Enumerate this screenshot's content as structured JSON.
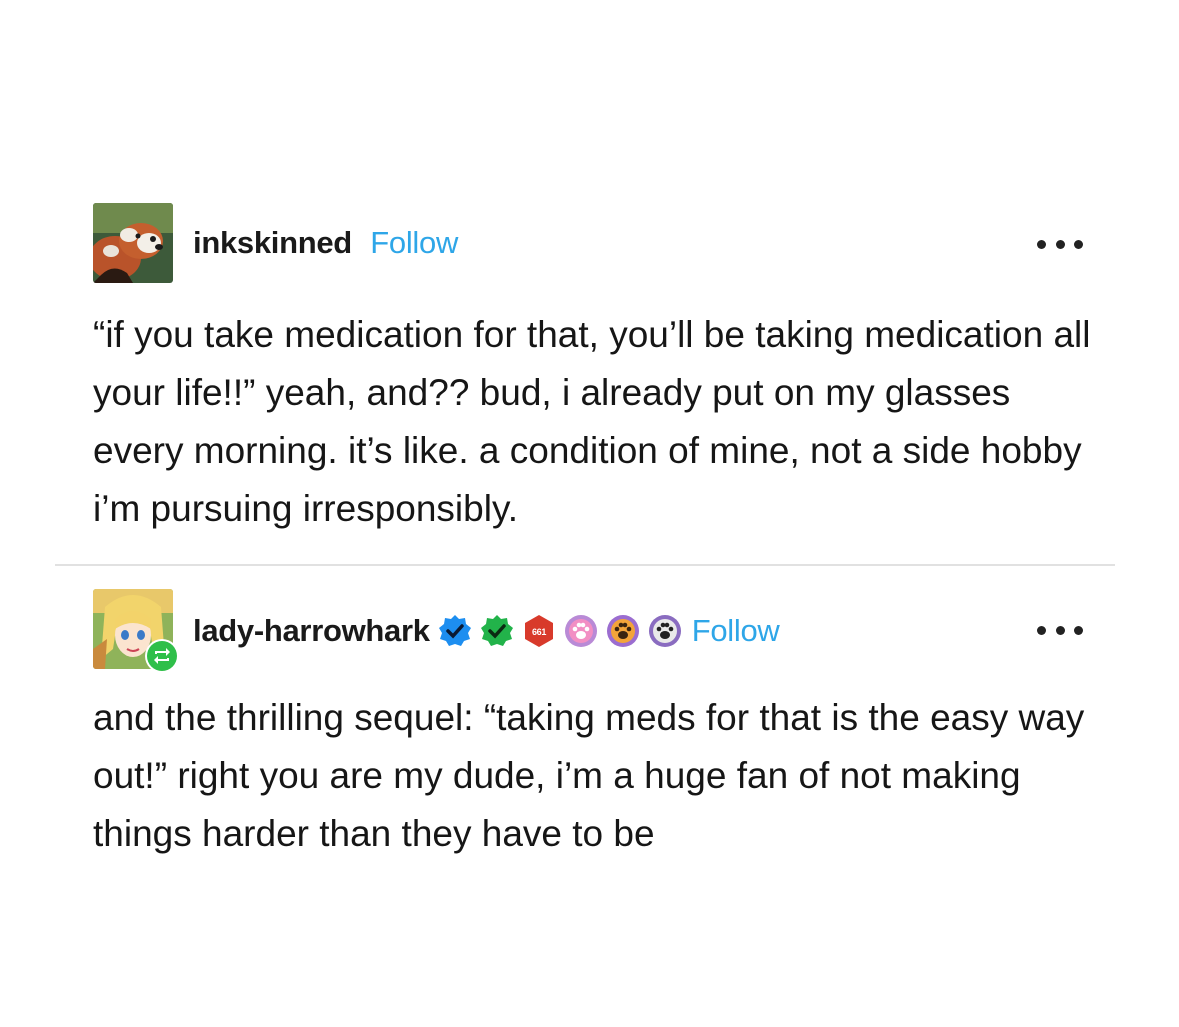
{
  "post1": {
    "username": "inkskinned",
    "follow_label": "Follow",
    "avatar_icon": "red-panda-avatar",
    "more_icon": "ellipsis-icon",
    "text": "“if you take medication for that, you’ll be taking medication all your life!!” yeah, and?? bud, i already put on my glasses every morning. it’s like. a condition of mine, not a side hobby i’m pursuing irresponsibly."
  },
  "post2": {
    "username": "lady-harrowhark",
    "follow_label": "Follow",
    "avatar_icon": "anime-character-avatar",
    "reblog_icon": "reblog-icon",
    "badges": [
      "blue-verified-badge",
      "green-verified-badge",
      "red-counter-badge",
      "pink-paw-badge",
      "orange-paw-badge",
      "gray-paw-badge"
    ],
    "badge_counter_text": "661",
    "more_icon": "ellipsis-icon",
    "text": "and the thrilling sequel: “taking meds for that is the easy way out!” right you are my dude, i’m a huge fan of not making things harder than they have to be"
  },
  "colors": {
    "follow": "#2ea6e8",
    "text": "#161616",
    "divider": "#e1e1e1",
    "reblog_green": "#2fbf4a"
  }
}
